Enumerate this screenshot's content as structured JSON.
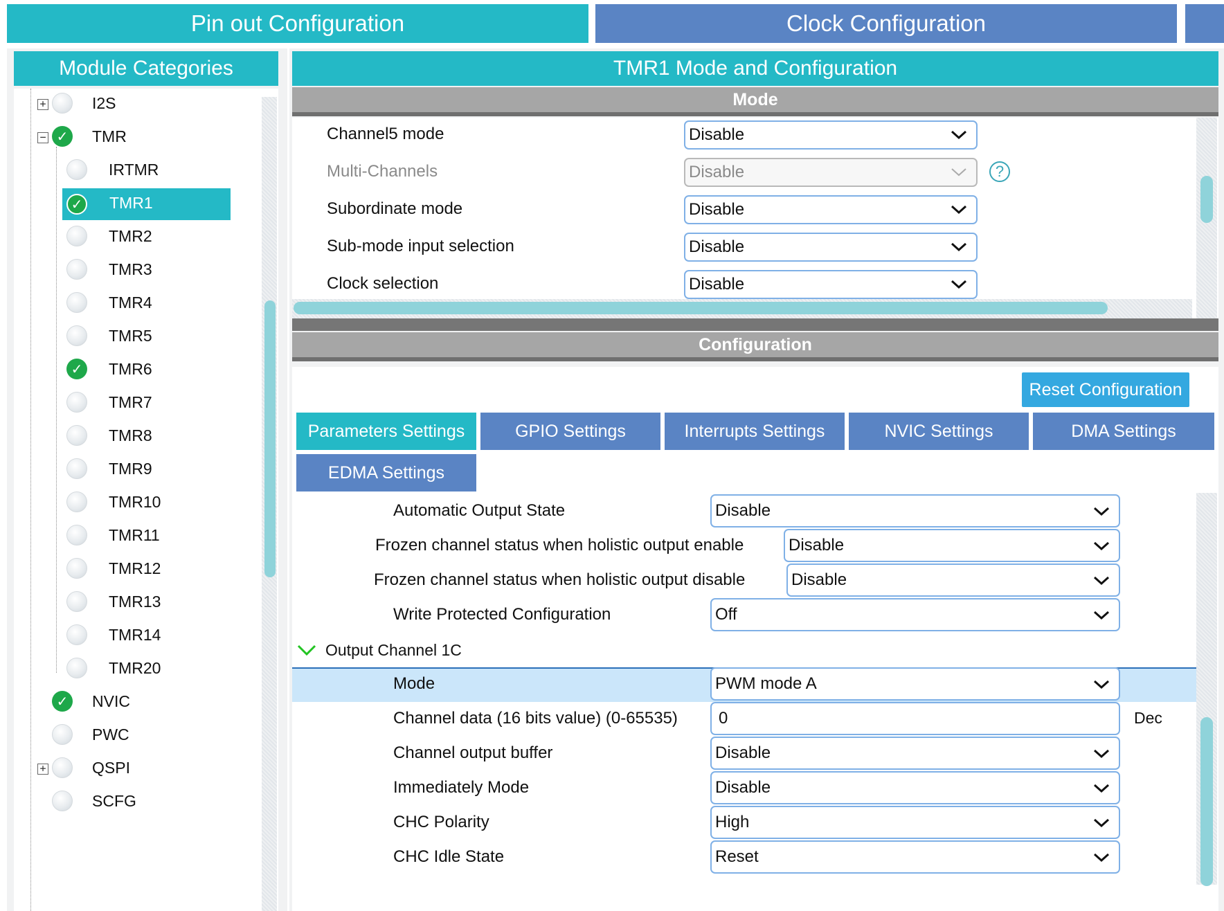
{
  "top_tabs": {
    "pinout": "Pin out  Configuration",
    "clock": "Clock Configuration"
  },
  "left": {
    "header": "Module Categories",
    "tree": [
      {
        "label": "I2S",
        "state": "none",
        "expander": "+"
      },
      {
        "label": "TMR",
        "state": "check",
        "expander": "−"
      },
      {
        "label": "IRTMR",
        "state": "none"
      },
      {
        "label": "TMR1",
        "state": "check",
        "selected": true
      },
      {
        "label": "TMR2",
        "state": "none"
      },
      {
        "label": "TMR3",
        "state": "none"
      },
      {
        "label": "TMR4",
        "state": "none"
      },
      {
        "label": "TMR5",
        "state": "none"
      },
      {
        "label": "TMR6",
        "state": "check"
      },
      {
        "label": "TMR7",
        "state": "none"
      },
      {
        "label": "TMR8",
        "state": "none"
      },
      {
        "label": "TMR9",
        "state": "none"
      },
      {
        "label": "TMR10",
        "state": "none"
      },
      {
        "label": "TMR11",
        "state": "none"
      },
      {
        "label": "TMR12",
        "state": "none"
      },
      {
        "label": "TMR13",
        "state": "none"
      },
      {
        "label": "TMR14",
        "state": "none"
      },
      {
        "label": "TMR20",
        "state": "none"
      },
      {
        "label": "NVIC",
        "state": "check"
      },
      {
        "label": "PWC",
        "state": "none"
      },
      {
        "label": "QSPI",
        "state": "none",
        "expander": "+"
      },
      {
        "label": "SCFG",
        "state": "none"
      }
    ]
  },
  "right": {
    "header": "TMR1 Mode and Configuration",
    "mode_title": "Mode",
    "mode_rows": [
      {
        "label": "Channel5 mode",
        "value": "Disable"
      },
      {
        "label": "Multi-Channels",
        "value": "Disable",
        "disabled": true
      },
      {
        "label": "Subordinate mode",
        "value": "Disable"
      },
      {
        "label": "Sub-mode input selection",
        "value": "Disable"
      },
      {
        "label": "Clock selection",
        "value": "Disable"
      }
    ],
    "config_title": "Configuration",
    "reset_button": "Reset Configuration",
    "tabs": [
      "Parameters Settings",
      "GPIO Settings",
      "Interrupts Settings",
      "NVIC Settings",
      "DMA Settings",
      "EDMA Settings"
    ],
    "params": [
      {
        "label": "Automatic Output State",
        "value": "Disable"
      },
      {
        "label": "Frozen channel status when holistic output enable",
        "value": "Disable"
      },
      {
        "label": "Frozen channel status when holistic output disable",
        "value": "Disable"
      },
      {
        "label": "Write Protected Configuration",
        "value": "Off"
      }
    ],
    "channel_section": "Output Channel 1C",
    "channel_rows": [
      {
        "label": "Mode",
        "value": "PWM mode A"
      },
      {
        "label": "Channel data (16 bits value) (0-65535)",
        "value": "0",
        "unit": "Dec"
      },
      {
        "label": "Channel output buffer",
        "value": "Disable"
      },
      {
        "label": "Immediately Mode",
        "value": "Disable"
      },
      {
        "label": "CHC Polarity",
        "value": "High"
      },
      {
        "label": "CHC Idle State",
        "value": "Reset"
      }
    ]
  },
  "colors": {
    "teal": "#24b9c6",
    "blue_tab": "#5a84c4",
    "check_green": "#1ea84a",
    "reset_blue": "#34a8e0"
  }
}
